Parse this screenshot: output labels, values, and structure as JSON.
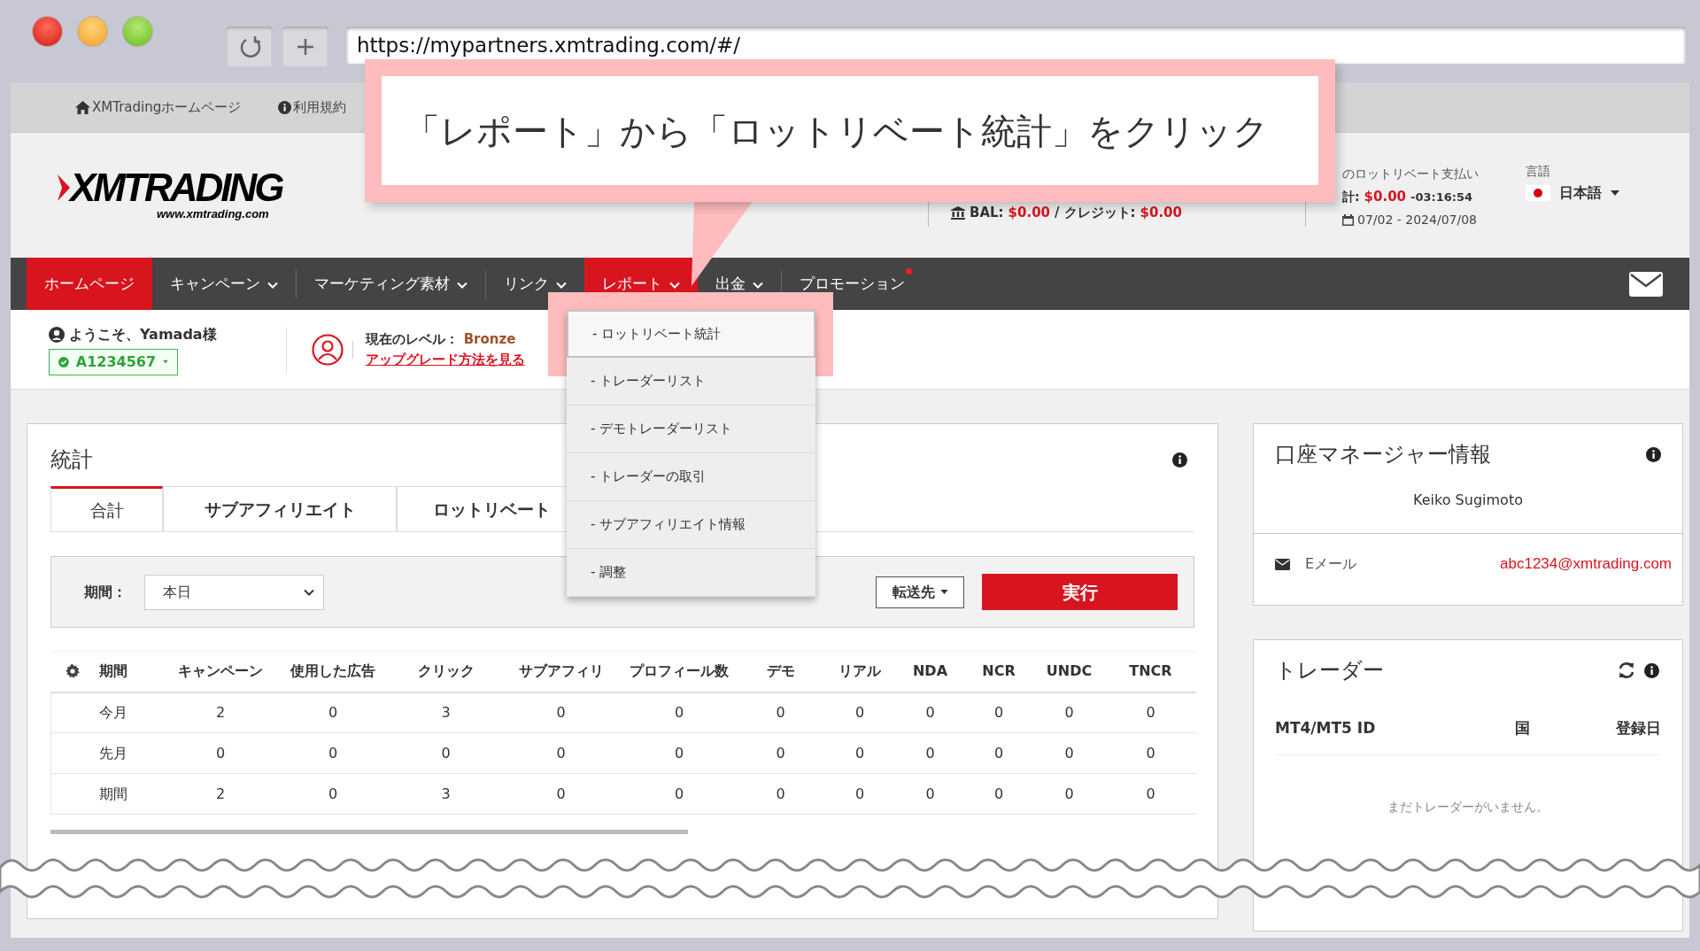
{
  "browser": {
    "url": "https://mypartners.xmtrading.com/#/"
  },
  "callout": {
    "text": "「レポート」から「ロットリベート統計」をクリック"
  },
  "top_links": [
    {
      "label": "XMTradingホームページ",
      "kind": "home"
    },
    {
      "label": "利用規約",
      "kind": "info"
    }
  ],
  "logo": {
    "name": "XMTRADING",
    "url": "www.xmtrading.com"
  },
  "header": {
    "balance_label": "BAL:",
    "balance": "$0.00",
    "separator": "/",
    "credit_label": "クレジット:",
    "credit": "$0.00",
    "rebate_title": "のロットリベート支払い",
    "total_label": "計:",
    "total": "$0.00",
    "countdown": "-03:16:54",
    "date_range": "07/02 - 2024/07/08",
    "language_label": "言語",
    "language": "日本語"
  },
  "nav": [
    {
      "label": "ホームページ",
      "selected": true,
      "open": false,
      "dropdown": false,
      "dot": false
    },
    {
      "label": "キャンペーン",
      "selected": false,
      "open": false,
      "dropdown": true,
      "dot": false
    },
    {
      "label": "マーケティング素材",
      "selected": false,
      "open": false,
      "dropdown": true,
      "dot": false
    },
    {
      "label": "リンク",
      "selected": false,
      "open": false,
      "dropdown": true,
      "dot": false
    },
    {
      "label": "レポート",
      "selected": false,
      "open": true,
      "dropdown": true,
      "dot": false
    },
    {
      "label": "出金",
      "selected": false,
      "open": false,
      "dropdown": true,
      "dot": false
    },
    {
      "label": "プロモーション",
      "selected": false,
      "open": false,
      "dropdown": false,
      "dot": true
    }
  ],
  "dropdown_menu": [
    {
      "label": "- ロットリベート統計",
      "highlighted": true
    },
    {
      "label": "- トレーダーリスト",
      "highlighted": false
    },
    {
      "label": "- デモトレーダーリスト",
      "highlighted": false
    },
    {
      "label": "- トレーダーの取引",
      "highlighted": false
    },
    {
      "label": "- サブアフィリエイト情報",
      "highlighted": false
    },
    {
      "label": "- 調整",
      "highlighted": false
    }
  ],
  "user": {
    "welcome": "ようこそ、Yamada様",
    "account": "A1234567",
    "level_label": "現在のレベル：",
    "level": "Bronze",
    "upgrade_link": "アップグレード方法を見る"
  },
  "stats": {
    "title": "統計",
    "tabs": [
      {
        "label": "合計",
        "selected": true
      },
      {
        "label": "サブアフィリエイト",
        "selected": false
      },
      {
        "label": "ロットリベート",
        "selected": false
      }
    ],
    "period_label": "期間：",
    "period_value": "本日",
    "transfer_button": "転送先",
    "run_button": "実行",
    "table": {
      "columns": [
        "期間",
        "キャンペーン",
        "使用した広告",
        "クリック",
        "サブアフィリ",
        "プロフィール数",
        "デモ",
        "リアル",
        "NDA",
        "NCR",
        "UNDC",
        "TNCR"
      ],
      "rows": [
        [
          "今月",
          "2",
          "0",
          "3",
          "0",
          "0",
          "0",
          "0",
          "0",
          "0",
          "0",
          "0"
        ],
        [
          "先月",
          "0",
          "0",
          "0",
          "0",
          "0",
          "0",
          "0",
          "0",
          "0",
          "0",
          "0"
        ],
        [
          "期間",
          "2",
          "0",
          "3",
          "0",
          "0",
          "0",
          "0",
          "0",
          "0",
          "0",
          "0"
        ]
      ]
    }
  },
  "account_manager": {
    "title": "口座マネージャー情報",
    "name": "Keiko Sugimoto",
    "email_label": "Eメール",
    "email": "abc1234@xmtrading.com"
  },
  "traders": {
    "title": "トレーダー",
    "columns": [
      "MT4/MT5 ID",
      "国",
      "登録日"
    ],
    "empty": "まだトレーダーがいません。"
  }
}
